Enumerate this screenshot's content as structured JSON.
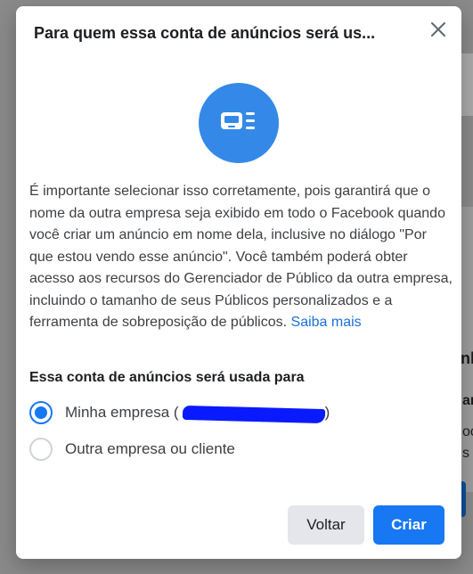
{
  "background": {
    "partial_heading": "nh",
    "partial_text_1": "ar",
    "partial_text_2": "oc",
    "partial_text_3": "s"
  },
  "modal": {
    "title": "Para quem essa conta de anúncios será us...",
    "close_icon": "close-icon",
    "hero_icon": "ad-account-icon",
    "description": "É importante selecionar isso corretamente, pois garantirá que o nome da outra empresa seja exibido em todo o Facebook quando você criar um anúncio em nome dela, inclusive no diálogo \"Por que estou vendo esse anúncio\". Você também poderá obter acesso aos recursos do Gerenciador de Público da outra empresa, incluindo o tamanho de seus Públicos personalizados e a ferramenta de sobreposição de públicos.",
    "learn_more": "Saiba mais",
    "question": "Essa conta de anúncios será usada para",
    "options": [
      {
        "label": "Minha empresa (",
        "suffix": ")",
        "selected": true
      },
      {
        "label": "Outra empresa ou cliente",
        "selected": false
      }
    ],
    "back_label": "Voltar",
    "create_label": "Criar"
  },
  "colors": {
    "accent": "#1877f2",
    "hero_bg": "#3489e8",
    "link": "#1c6fd8"
  }
}
